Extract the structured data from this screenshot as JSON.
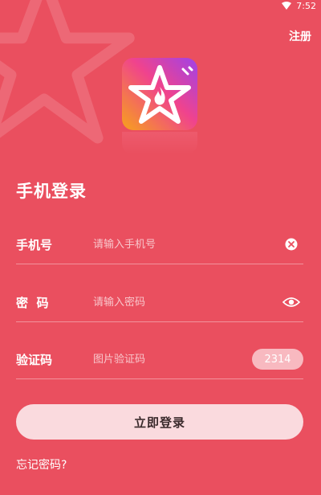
{
  "status_bar": {
    "time": "7:52"
  },
  "header": {
    "register_label": "注册"
  },
  "login": {
    "title": "手机登录",
    "phone": {
      "label": "手机号",
      "placeholder": "请输入手机号",
      "value": ""
    },
    "password": {
      "label": "密  码",
      "placeholder": "请输入密码",
      "value": ""
    },
    "captcha": {
      "label": "验证码",
      "placeholder": "图片验证码",
      "value": "",
      "image_text": "2314"
    },
    "submit_label": "立即登录",
    "forgot_label": "忘记密码?"
  },
  "icons": {
    "clear": "clear-icon",
    "eye": "eye-icon",
    "logo": "star-flame-logo"
  },
  "colors": {
    "background": "#ea4f5f",
    "button": "#fadade",
    "captcha_bg": "#f8b9c0"
  }
}
